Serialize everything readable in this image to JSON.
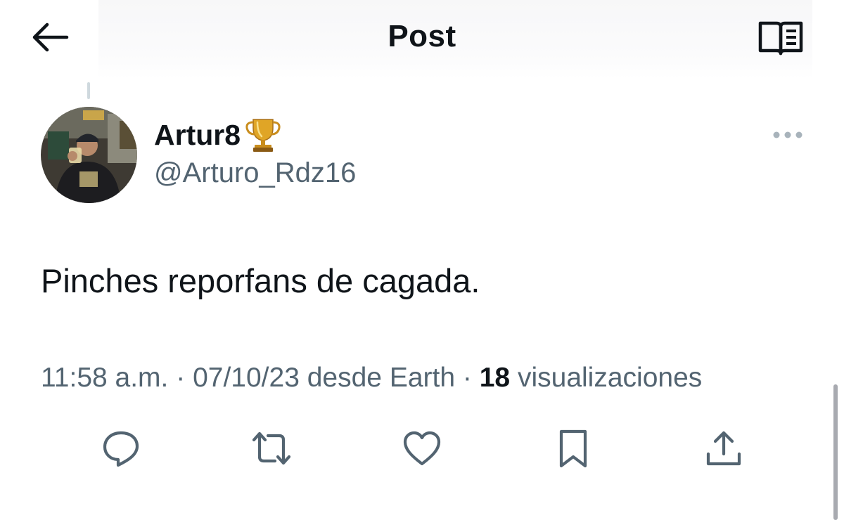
{
  "header": {
    "title": "Post",
    "back_icon": "arrow-left-icon",
    "reader_icon": "reader-mode-icon"
  },
  "author": {
    "display_name": "Artur8",
    "badge_emoji": "trophy-icon",
    "handle": "@Arturo_Rdz16"
  },
  "tweet": {
    "text": "Pinches reporfans de cagada.",
    "time": "11:58 a.m.",
    "separator": "·",
    "date": "07/10/23",
    "source": "desde Earth",
    "views_count": "18",
    "views_label": "visualizaciones"
  },
  "actions": [
    {
      "name": "reply",
      "icon": "reply-icon"
    },
    {
      "name": "repost",
      "icon": "repost-icon"
    },
    {
      "name": "like",
      "icon": "heart-icon"
    },
    {
      "name": "bookmark",
      "icon": "bookmark-icon"
    },
    {
      "name": "share",
      "icon": "share-icon"
    }
  ],
  "colors": {
    "text_primary": "#0f1419",
    "text_secondary": "#536471",
    "divider": "#cfd9de"
  }
}
